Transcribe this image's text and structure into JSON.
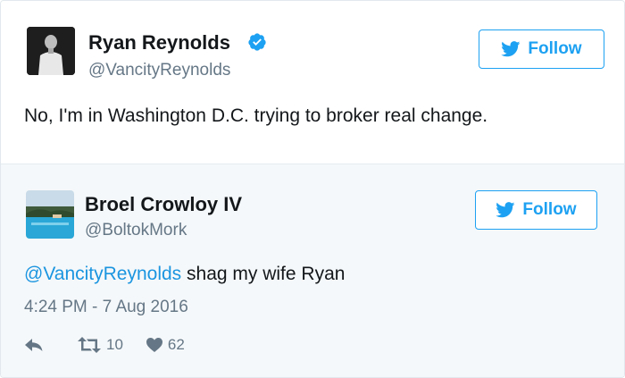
{
  "original_tweet": {
    "display_name": "Ryan Reynolds",
    "handle": "@VancityReynolds",
    "verified": true,
    "follow_label": "Follow",
    "text": "No, I'm in Washington D.C. trying to broker real change."
  },
  "reply_tweet": {
    "display_name": "Broel Crowloy IV",
    "handle": "@BoltokMork",
    "follow_label": "Follow",
    "mention": "@VancityReynolds",
    "text": " shag my wife Ryan",
    "timestamp": "4:24 PM - 7 Aug 2016",
    "retweet_count": "10",
    "like_count": "62"
  },
  "colors": {
    "accent": "#1da1f2",
    "mention": "#1b95e0",
    "secondary_text": "#657786",
    "reply_background": "#f5f8fa"
  },
  "icons": [
    "verified-badge-icon",
    "twitter-bird-icon",
    "reply-icon",
    "retweet-icon",
    "heart-icon"
  ]
}
